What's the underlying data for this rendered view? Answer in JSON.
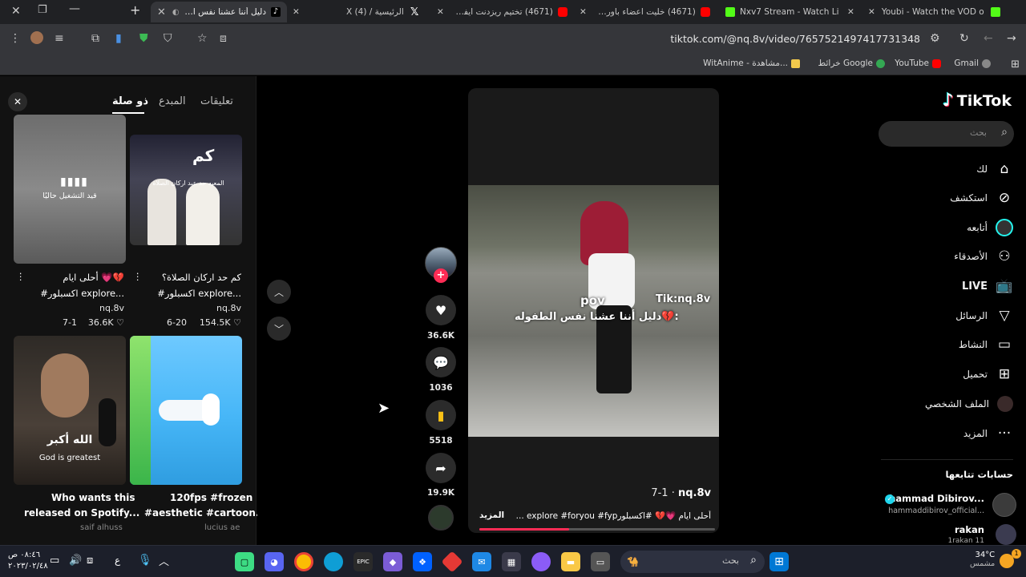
{
  "browser": {
    "tabs": [
      {
        "title": "Youbi - Watch the VOD on",
        "color": "#53fc18"
      },
      {
        "title": "Nxv7 Stream - Watch Live",
        "color": "#53fc18"
      },
      {
        "title": "(4671) خليت اعضاء باور يجر",
        "color": "#ff0000"
      },
      {
        "title": "(4671) تختيم ريزدنت ايفل 7",
        "color": "#ff0000"
      },
      {
        "title": "الرئيسية / X (4)",
        "color": "#ffffff"
      },
      {
        "title": "دليل أننا عشنا نفس الط",
        "color": "#25f4ee"
      }
    ],
    "url": "tiktok.com/@nq.8v/video/7657521497417731348",
    "bookmarks": [
      "Gmail",
      "YouTube",
      "خرائط Google",
      "WitAnime - مشاهدة..."
    ]
  },
  "panel": {
    "tabs": {
      "comments": "تعليقات",
      "creator": "المبدع",
      "related": "ذو صلة"
    },
    "cards": [
      {
        "title_line1": "كم حد اركان الصلاة؟",
        "title_line2": "#اكسبلور explore...",
        "author": "nq.8v",
        "likes": "154.5K",
        "date": "6-20",
        "overlay_big": "كم",
        "overlay_small": "المعيه حد عيد اركان الصلاة"
      },
      {
        "title_line1": "أحلى ايام 💗💔",
        "title_line2": "#اكسبلور explore...",
        "author": "nq.8v",
        "likes": "36.6K",
        "date": "7-1",
        "overlay_playing": "قيد التشغيل حاليًا"
      },
      {
        "title_line1": "120fps #frozen",
        "title_line2": "#aesthetic #cartoon...",
        "author": "lucius ae"
      },
      {
        "title_line1": "Who wants this",
        "title_line2": "released on Spotify...",
        "author": "saif alhuss",
        "overlay_ar": "الله أكبر",
        "overlay_en": "God is greatest"
      }
    ]
  },
  "video": {
    "overlay_pov": "pov",
    "overlay_tag": "Tik:nq.8v",
    "overlay_caption": "دليل أننا عشنا نفس الطفوله💔:",
    "author": "nq.8v",
    "date": "7-1",
    "caption": "أحلى ايام 💗💔 #اكسبلورexplore #foryou #fyp ...",
    "more": "المزيد",
    "progress": 0.38,
    "likes": "36.6K",
    "comments": "1036",
    "saves": "5518",
    "shares": "19.9K"
  },
  "sidebar": {
    "brand": "TikTok",
    "search_placeholder": "بحث",
    "nav": [
      {
        "label": "لك",
        "icon": "home-icon"
      },
      {
        "label": "استكشف",
        "icon": "compass-icon"
      },
      {
        "label": "أتابعه",
        "icon": "following-icon"
      },
      {
        "label": "الأصدقاء",
        "icon": "friends-icon"
      },
      {
        "label": "LIVE",
        "icon": "live-icon"
      },
      {
        "label": "الرسائل",
        "icon": "messages-icon"
      },
      {
        "label": "النشاط",
        "icon": "activity-icon"
      },
      {
        "label": "تحميل",
        "icon": "upload-icon"
      },
      {
        "label": "الملف الشخصي",
        "icon": "profile-icon"
      },
      {
        "label": "المزيد",
        "icon": "more-icon"
      }
    ],
    "following_title": "حسابات تتابعها",
    "following": [
      {
        "name": "hammad Dibirov...",
        "handle": "hammaddibirov_official..."
      },
      {
        "name": "rakan",
        "handle": "1rakan 11"
      }
    ]
  },
  "taskbar": {
    "search": "بحث",
    "weather_temp": "34°C",
    "weather_desc": "مشمس",
    "time": "٠٨:٤٦ ص",
    "date": "٢٠٢٣/٠٢/٤٨",
    "lang": "ع"
  }
}
